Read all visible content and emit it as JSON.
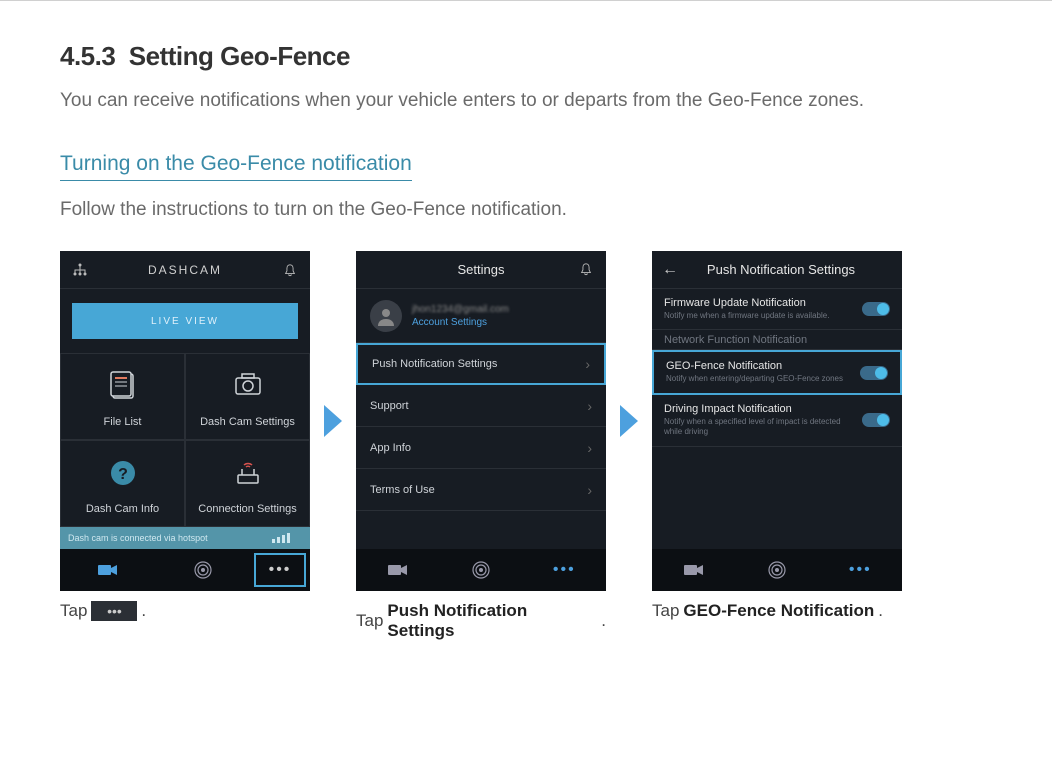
{
  "doc": {
    "heading_num": "4.5.3",
    "heading_text": "Setting Geo-Fence",
    "intro": "You can receive notifications when your vehicle enters to or departs from the Geo-Fence zones.",
    "subheading": "Turning on the Geo-Fence notification",
    "instruction": "Follow the instructions to turn on the Geo-Fence notification."
  },
  "screen1": {
    "title": "DASHCAM",
    "live_view": "LIVE VIEW",
    "cells": {
      "file_list": "File List",
      "dashcam_settings": "Dash Cam Settings",
      "dashcam_info": "Dash Cam Info",
      "connection_settings": "Connection Settings"
    },
    "status": "Dash cam is connected via hotspot"
  },
  "screen2": {
    "title": "Settings",
    "account_link": "Account Settings",
    "rows": {
      "push": "Push Notification Settings",
      "support": "Support",
      "app_info": "App Info",
      "terms": "Terms of Use"
    }
  },
  "screen3": {
    "title": "Push Notification Settings",
    "rows": {
      "firmware_title": "Firmware Update Notification",
      "firmware_sub": "Notify me when a firmware update is available.",
      "netfunc_title": "Network Function Notification",
      "geo_title": "GEO-Fence Notification",
      "geo_sub": "Notify when entering/departing GEO-Fence zones",
      "impact_title": "Driving Impact Notification",
      "impact_sub": "Notify when a specified level of impact is detected while driving"
    }
  },
  "captions": {
    "c1_pre": "Tap ",
    "c1_post": ".",
    "c2_pre": "Tap ",
    "c2_bold": "Push Notification Settings",
    "c2_post": ".",
    "c3_pre": "Tap ",
    "c3_bold": "GEO-Fence Notification",
    "c3_post": "."
  }
}
